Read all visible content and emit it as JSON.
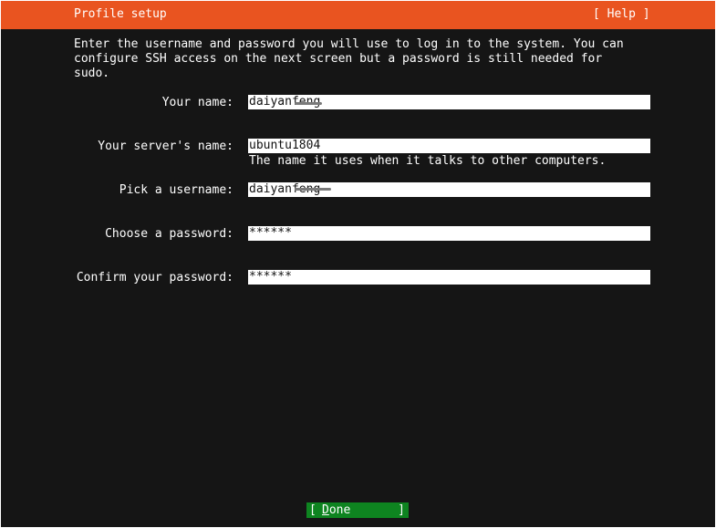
{
  "header": {
    "title": "Profile setup",
    "help_label": "[ Help ]"
  },
  "intro": {
    "text": "Enter the username and password you will use to log in to the system. You can\nconfigure SSH access on the next screen but a password is still needed for\nsudo."
  },
  "form": {
    "name": {
      "label": "Your name:",
      "value": "daiyanfeng"
    },
    "server": {
      "label": "Your server's name:",
      "value": "ubuntu1804",
      "hint": "The name it uses when it talks to other computers."
    },
    "username": {
      "label": "Pick a username:",
      "value": "daiyanfeng"
    },
    "password": {
      "label": "Choose a password:",
      "value": "******"
    },
    "confirm": {
      "label": "Confirm your password:",
      "value": "******"
    }
  },
  "footer": {
    "done_open": "[",
    "done_label": "Done",
    "done_close": "]"
  },
  "colors": {
    "header_bg": "#e95420",
    "background": "#151515",
    "done_bg": "#0e8420"
  }
}
